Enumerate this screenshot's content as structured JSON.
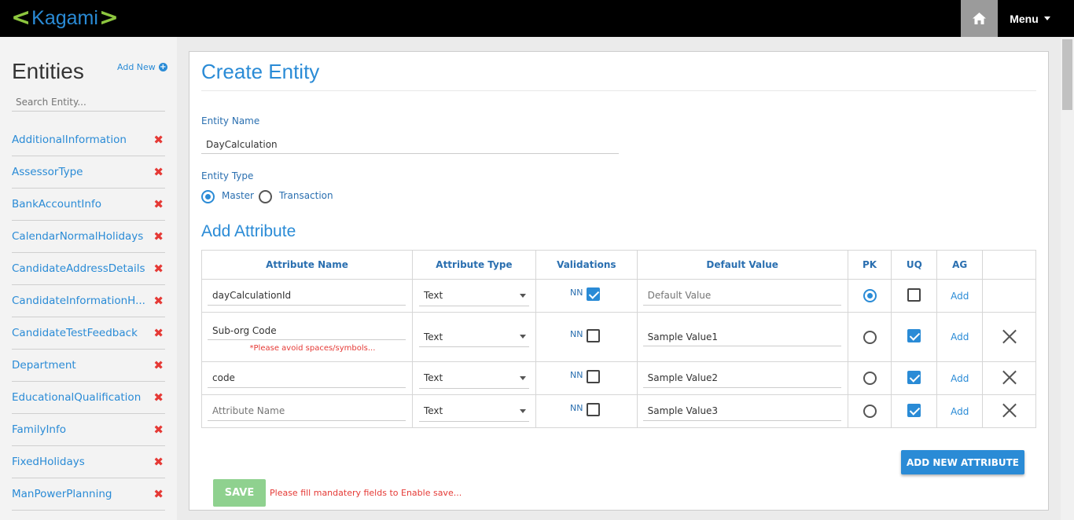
{
  "header": {
    "logo_text": "Kagami",
    "logo_left": "<",
    "logo_right": ">",
    "menu_label": "Menu"
  },
  "sidebar": {
    "title": "Entities",
    "add_new_label": "Add New",
    "search_placeholder": "Search Entity...",
    "items": [
      {
        "label": "AdditionalInformation"
      },
      {
        "label": "AssessorType"
      },
      {
        "label": "BankAccountInfo"
      },
      {
        "label": "CalendarNormalHolidays"
      },
      {
        "label": "CandidateAddressDetails"
      },
      {
        "label": "CandidateInformationH..."
      },
      {
        "label": "CandidateTestFeedback"
      },
      {
        "label": "Department"
      },
      {
        "label": "EducationalQualification"
      },
      {
        "label": "FamilyInfo"
      },
      {
        "label": "FixedHolidays"
      },
      {
        "label": "ManPowerPlanning"
      }
    ],
    "delete_glyph": "✖"
  },
  "main": {
    "title": "Create Entity",
    "entity_name_label": "Entity Name",
    "entity_name_value": "DayCalculation",
    "entity_type_label": "Entity Type",
    "entity_types": [
      {
        "label": "Master",
        "selected": true
      },
      {
        "label": "Transaction",
        "selected": false
      }
    ],
    "add_attribute_title": "Add Attribute",
    "table": {
      "headers": [
        "Attribute Name",
        "Attribute Type",
        "Validations",
        "Default Value",
        "PK",
        "UQ",
        "AG",
        ""
      ],
      "nn_label": "NN",
      "add_label": "Add",
      "rows": [
        {
          "name": "dayCalculationId",
          "name_placeholder": "",
          "type": "Text",
          "nn": true,
          "default_value": "",
          "default_placeholder": "Default Value",
          "pk": true,
          "uq": false,
          "deletable": false,
          "warning": ""
        },
        {
          "name": "Sub-org Code",
          "name_placeholder": "",
          "type": "Text",
          "nn": false,
          "default_value": "Sample Value1",
          "default_placeholder": "",
          "pk": false,
          "uq": true,
          "deletable": true,
          "warning": "*Please avoid spaces/symbols..."
        },
        {
          "name": "code",
          "name_placeholder": "",
          "type": "Text",
          "nn": false,
          "default_value": "Sample Value2",
          "default_placeholder": "",
          "pk": false,
          "uq": true,
          "deletable": true,
          "warning": ""
        },
        {
          "name": "",
          "name_placeholder": "Attribute Name",
          "type": "Text",
          "nn": false,
          "default_value": "Sample Value3",
          "default_placeholder": "",
          "pk": false,
          "uq": true,
          "deletable": true,
          "warning": ""
        }
      ]
    },
    "add_new_attribute_label": "ADD NEW ATTRIBUTE",
    "save_label": "SAVE",
    "save_warning": "Please fill mandatery fields to Enable save..."
  },
  "colors": {
    "accent": "#2a8bd6",
    "logo_green": "#8dc63f",
    "danger": "#e53935",
    "save_disabled": "#8fd18f"
  }
}
